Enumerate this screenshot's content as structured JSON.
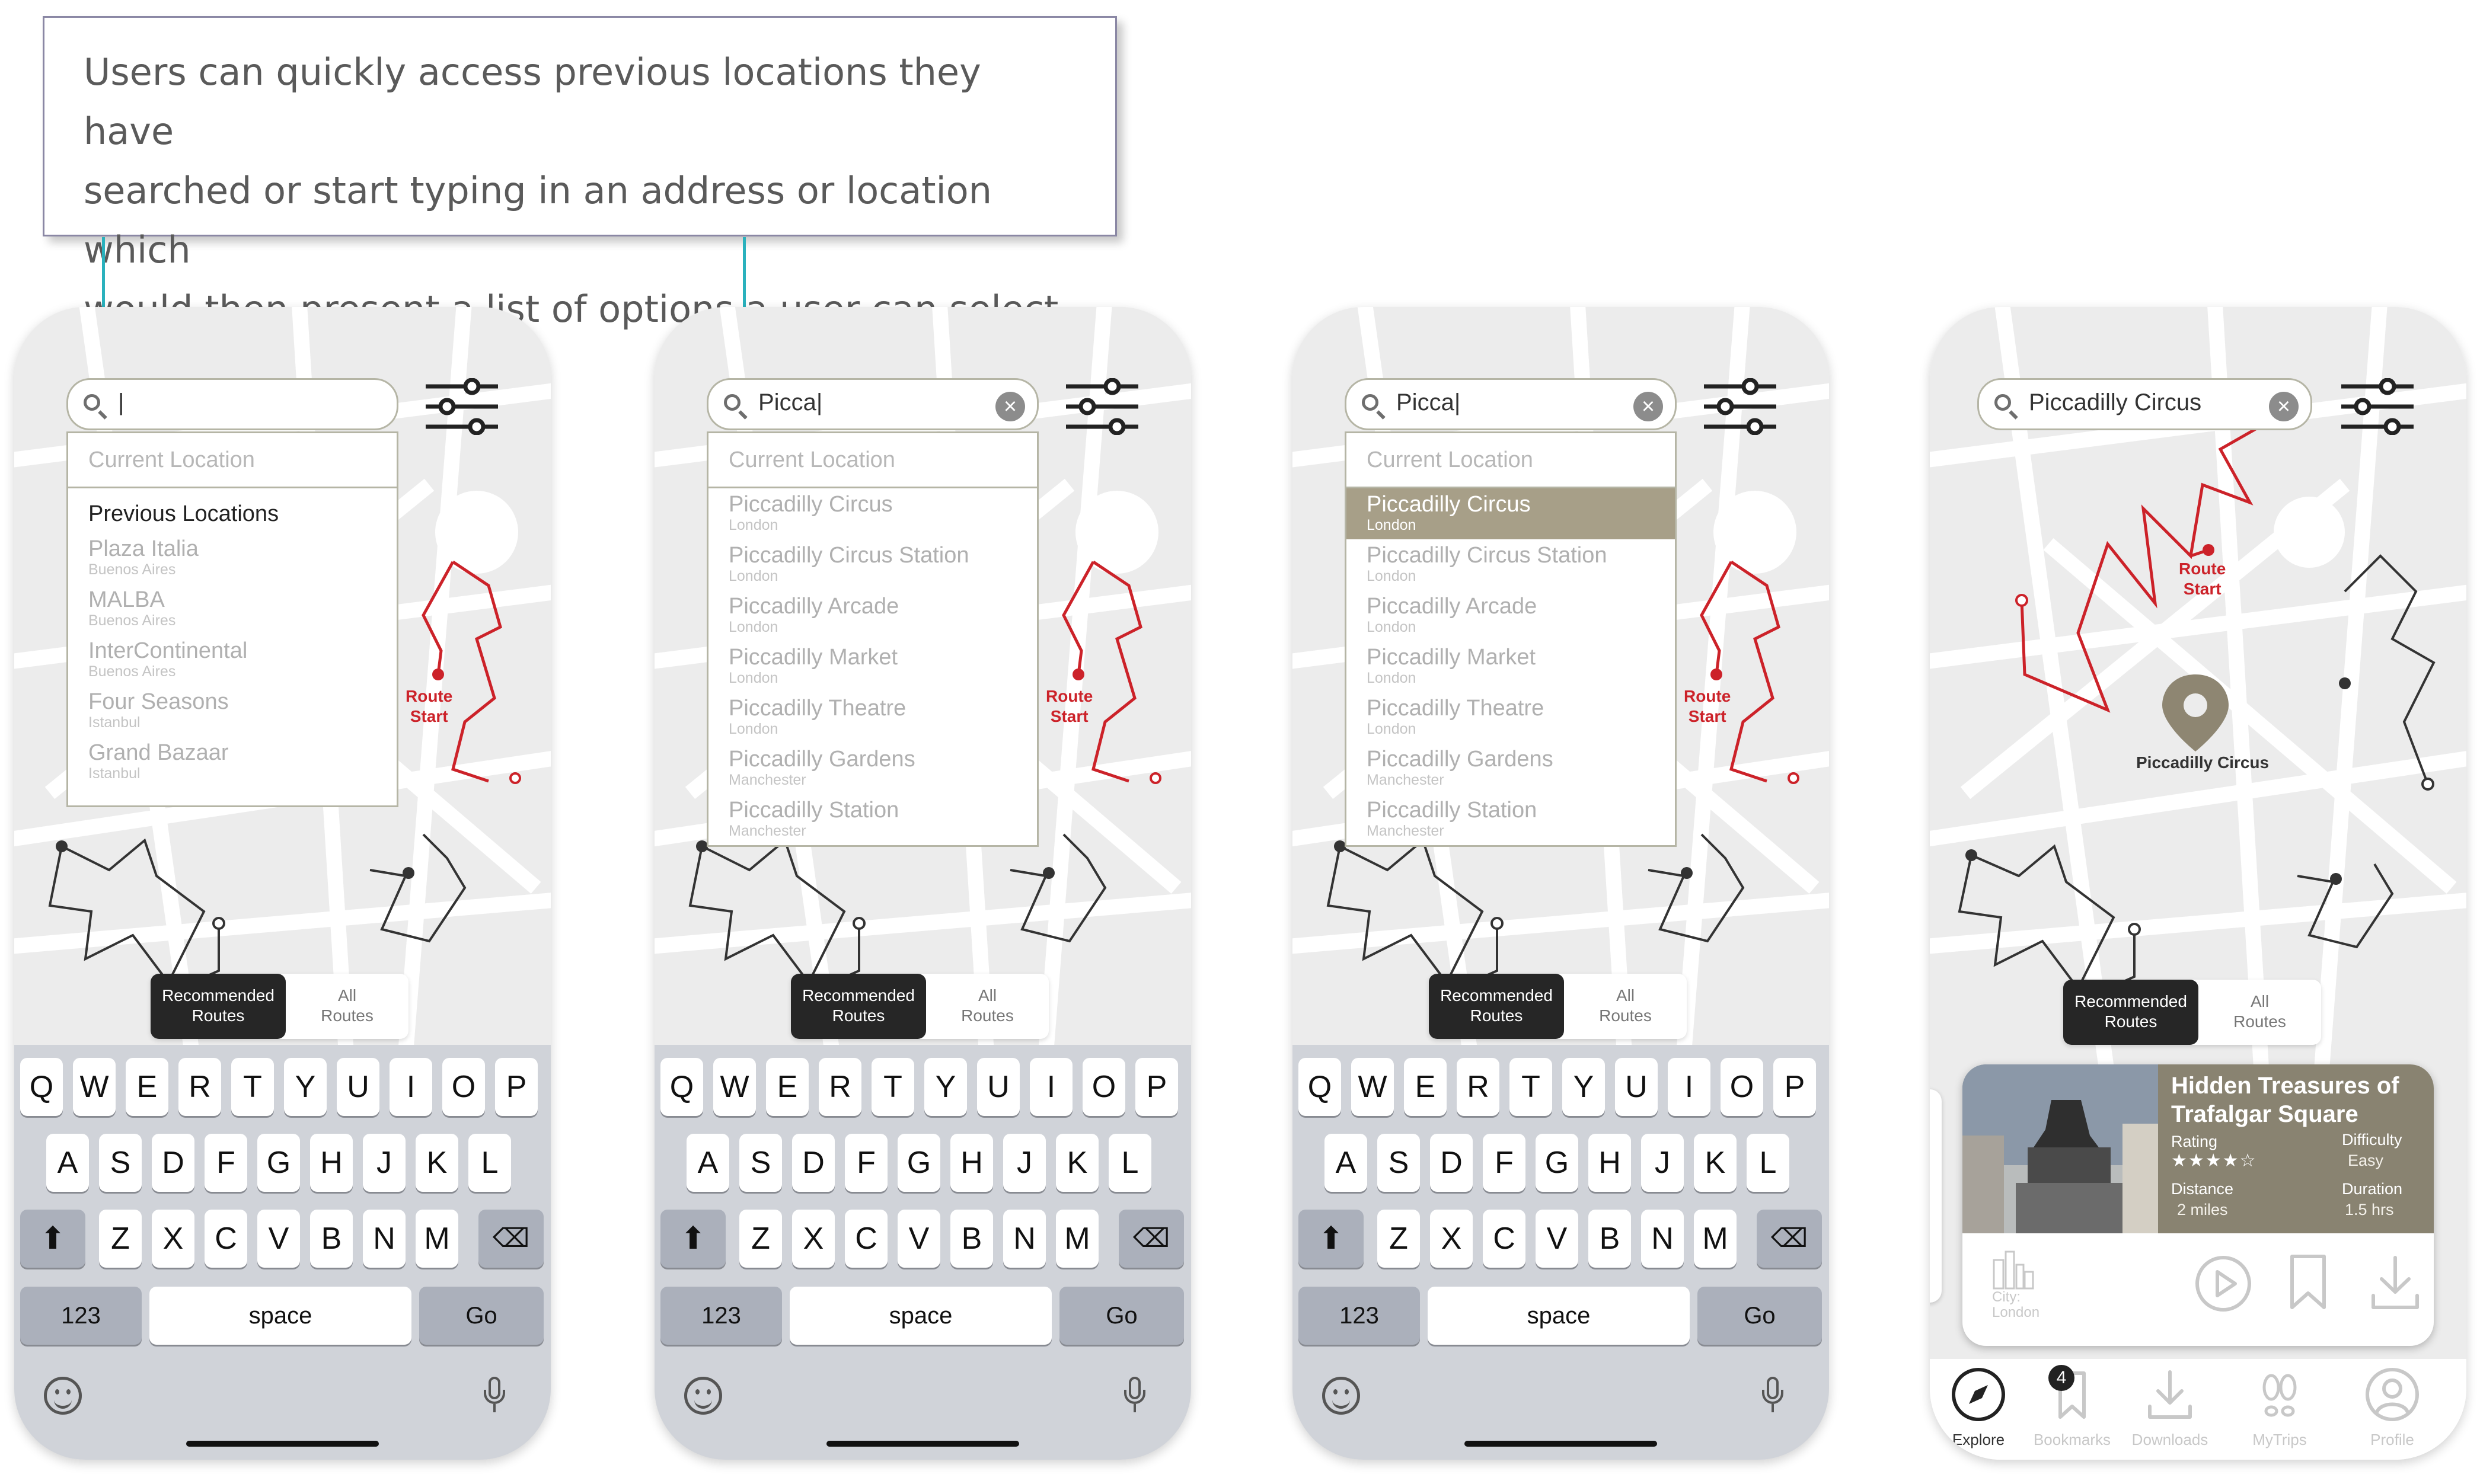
{
  "annotation": {
    "line1": "Users can quickly access previous locations they have",
    "line2": "searched or start typing in an address or location which",
    "line3": "would then present a list of options a user can select from"
  },
  "colors": {
    "route": "#cc2229",
    "accent": "#2ab1bd",
    "selected": "#a79f88",
    "card_info": "#898371"
  },
  "icons": {
    "search": "search-icon",
    "filter": "sliders-icon",
    "clear": "close-icon"
  },
  "screens": [
    {
      "search_value": "|",
      "current_location": "Current Location",
      "previous_heading": "Previous Locations",
      "items": [
        {
          "name": "Plaza Italia",
          "city": "Buenos Aires"
        },
        {
          "name": "MALBA",
          "city": "Buenos Aires"
        },
        {
          "name": "InterContinental",
          "city": "Buenos Aires"
        },
        {
          "name": "Four Seasons",
          "city": "Istanbul"
        },
        {
          "name": "Grand Bazaar",
          "city": "Istanbul"
        }
      ]
    },
    {
      "search_value": "Picca|",
      "current_location": "Current Location",
      "items": [
        {
          "name": "Piccadilly Circus",
          "city": "London"
        },
        {
          "name": "Piccadilly Circus Station",
          "city": "London"
        },
        {
          "name": "Piccadilly Arcade",
          "city": "London"
        },
        {
          "name": "Piccadilly Market",
          "city": "London"
        },
        {
          "name": "Piccadilly Theatre",
          "city": "London"
        },
        {
          "name": "Piccadilly Gardens",
          "city": "Manchester"
        },
        {
          "name": "Piccadilly Station",
          "city": "Manchester"
        }
      ]
    },
    {
      "search_value": "Picca|",
      "current_location": "Current Location",
      "selected_index": 0
    },
    {
      "search_value": "Piccadilly Circus",
      "pin_label": "Piccadilly Circus",
      "card": {
        "title_line1": "Hidden Treasures of",
        "title_line2": "Trafalgar Square",
        "rating_label": "Rating",
        "rating": 4,
        "rating_stars": "★★★★☆",
        "difficulty_label": "Difficulty",
        "difficulty": "Easy",
        "distance_label": "Distance",
        "distance": "2 miles",
        "duration_label": "Duration",
        "duration": "1.5 hrs",
        "city_label": "City:",
        "city": "London"
      },
      "tabbar": [
        {
          "label": "Explore",
          "icon": "compass-icon"
        },
        {
          "label": "Bookmarks",
          "icon": "bookmark-icon",
          "badge": "4"
        },
        {
          "label": "Downloads",
          "icon": "download-icon"
        },
        {
          "label": "MyTrips",
          "icon": "footprints-icon"
        },
        {
          "label": "Profile",
          "icon": "profile-icon"
        }
      ]
    }
  ],
  "route_start": {
    "line1": "Route",
    "line2": "Start"
  },
  "toggle": {
    "rec_line1": "Recommended",
    "rec_line2": "Routes",
    "all_line1": "All",
    "all_line2": "Routes"
  },
  "keyboard": {
    "row1": [
      "Q",
      "W",
      "E",
      "R",
      "T",
      "Y",
      "U",
      "I",
      "O",
      "P"
    ],
    "row2": [
      "A",
      "S",
      "D",
      "F",
      "G",
      "H",
      "J",
      "K",
      "L"
    ],
    "row3": [
      "Z",
      "X",
      "C",
      "V",
      "B",
      "N",
      "M"
    ],
    "numbers": "123",
    "space": "space",
    "go": "Go",
    "shift_icon": "shift-icon",
    "backspace_icon": "backspace-icon",
    "emoji_icon": "emoji-icon",
    "mic_icon": "microphone-icon"
  }
}
